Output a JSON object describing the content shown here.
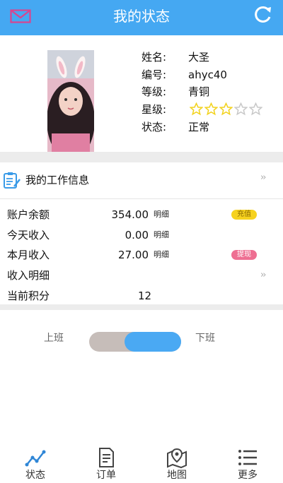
{
  "header": {
    "title": "我的状态",
    "mail_icon": "mail-icon",
    "refresh_icon": "refresh-icon"
  },
  "profile": {
    "rows": [
      {
        "label": "姓名:",
        "value": "大圣"
      },
      {
        "label": "编号:",
        "value": "ahyc40"
      },
      {
        "label": "等级:",
        "value": "青铜"
      },
      {
        "label": "星级:",
        "value": ""
      },
      {
        "label": "状态:",
        "value": "正常"
      }
    ],
    "stars_filled": 3,
    "stars_total": 5
  },
  "work": {
    "title": "我的工作信息",
    "chevron": "››"
  },
  "finance": {
    "balance": {
      "label": "账户余额",
      "amount": "354.00",
      "detail": "明细",
      "badge": "充值"
    },
    "today": {
      "label": "今天收入",
      "amount": "0.00",
      "detail": "明细"
    },
    "month": {
      "label": "本月收入",
      "amount": "27.00",
      "detail": "明细",
      "badge": "提现"
    },
    "income_detail": {
      "label": "收入明细",
      "chevron": "››"
    },
    "points": {
      "label": "当前积分",
      "value": "12"
    }
  },
  "duty": {
    "on_label": "上班",
    "off_label": "下班"
  },
  "tabs": [
    {
      "label": "状态",
      "icon": "status-chart-icon"
    },
    {
      "label": "订单",
      "icon": "order-document-icon"
    },
    {
      "label": "地图",
      "icon": "map-pin-icon"
    },
    {
      "label": "更多",
      "icon": "more-list-icon"
    }
  ],
  "colors": {
    "primary": "#45a8f2",
    "star": "#f2d21c",
    "badge_yellow": "#f6d21f",
    "badge_pink": "#ee6f92"
  }
}
